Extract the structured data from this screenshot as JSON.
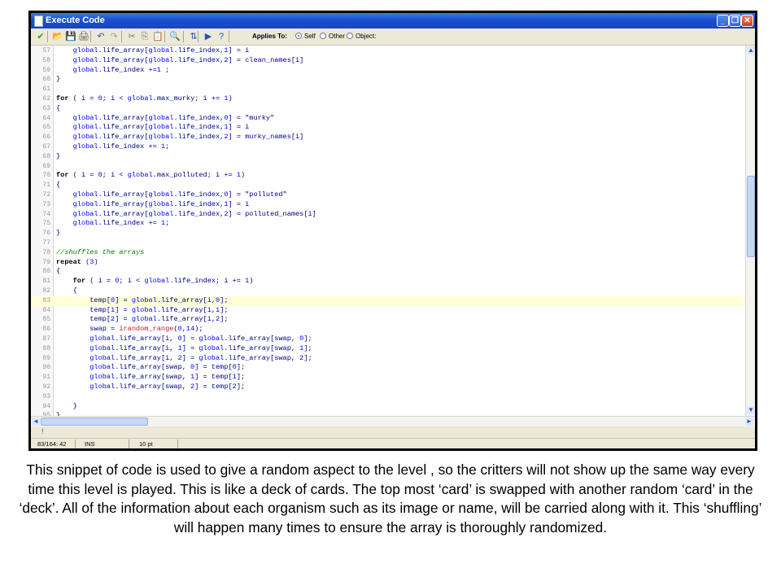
{
  "window": {
    "title": "Execute Code",
    "min_glyph": "_",
    "max_glyph": "❐",
    "close_glyph": "✕"
  },
  "toolbar": {
    "icons": [
      {
        "name": "check-icon",
        "glyph": "✔",
        "color": "#2e9a2e"
      },
      {
        "name": "open-folder-icon",
        "glyph": "📂",
        "color": "#c99a1a"
      },
      {
        "name": "save-icon",
        "glyph": "💾",
        "color": "#2b55a8"
      },
      {
        "name": "print-icon",
        "glyph": "🖨",
        "color": "#555555"
      },
      {
        "name": "undo-icon",
        "glyph": "↶",
        "color": "#2b55a8"
      },
      {
        "name": "redo-icon",
        "glyph": "↷",
        "color": "#9a9a9a"
      },
      {
        "name": "cut-icon",
        "glyph": "✂",
        "color": "#777777"
      },
      {
        "name": "copy-icon",
        "glyph": "⎘",
        "color": "#777777"
      },
      {
        "name": "paste-icon",
        "glyph": "📋",
        "color": "#777777"
      },
      {
        "name": "search-icon",
        "glyph": "🔍",
        "color": "#555555"
      },
      {
        "name": "goto-line-icon",
        "glyph": "⇅",
        "color": "#2b55a8"
      },
      {
        "name": "run-icon",
        "glyph": "▶",
        "color": "#2b55a8"
      },
      {
        "name": "help-icon",
        "glyph": "?",
        "color": "#2b55a8"
      }
    ],
    "applies_to_label": "Applies To:",
    "options": [
      {
        "label": "Self",
        "selected": true
      },
      {
        "label": "Other",
        "selected": false
      },
      {
        "label": "Object:",
        "selected": false
      }
    ]
  },
  "editor": {
    "lines": [
      {
        "n": "57",
        "text": "    global.life_array[global.life_index,1] = i"
      },
      {
        "n": "58",
        "text": "    global.life_array[global.life_index,2] = clean_names[i]"
      },
      {
        "n": "59",
        "text": "    global.life_index +=1 ;"
      },
      {
        "n": "60",
        "text": "}"
      },
      {
        "n": "61",
        "text": ""
      },
      {
        "n": "62",
        "text": "for ( i = 0; i < global.max_murky; i += 1)"
      },
      {
        "n": "63",
        "text": "{"
      },
      {
        "n": "64",
        "text": "    global.life_array[global.life_index,0] = \"murky\""
      },
      {
        "n": "65",
        "text": "    global.life_array[global.life_index,1] = i"
      },
      {
        "n": "66",
        "text": "    global.life_array[global.life_index,2] = murky_names[i]"
      },
      {
        "n": "67",
        "text": "    global.life_index += 1;"
      },
      {
        "n": "68",
        "text": "}"
      },
      {
        "n": "69",
        "text": ""
      },
      {
        "n": "70",
        "text": "for ( i = 0; i < global.max_polluted; i += 1)"
      },
      {
        "n": "71",
        "text": "{"
      },
      {
        "n": "72",
        "text": "    global.life_array[global.life_index,0] = \"polluted\""
      },
      {
        "n": "73",
        "text": "    global.life_array[global.life_index,1] = i"
      },
      {
        "n": "74",
        "text": "    global.life_array[global.life_index,2] = polluted_names[i]"
      },
      {
        "n": "75",
        "text": "    global.life_index += 1;"
      },
      {
        "n": "76",
        "text": "}"
      },
      {
        "n": "77",
        "text": ""
      },
      {
        "n": "78",
        "text": "//shuffles the arrays"
      },
      {
        "n": "79",
        "text": "repeat (3)"
      },
      {
        "n": "80",
        "text": "{"
      },
      {
        "n": "81",
        "text": "    for ( i = 0; i < global.life_index; i += 1)"
      },
      {
        "n": "82",
        "text": "    {"
      },
      {
        "n": "83",
        "text": "        temp[0] = global.life_array[i,0];",
        "highlight": true
      },
      {
        "n": "84",
        "text": "        temp[1] = global.life_array[i,1];"
      },
      {
        "n": "85",
        "text": "        temp[2] = global.life_array[i,2];"
      },
      {
        "n": "86",
        "text": "        swap = irandom_range(0,14);"
      },
      {
        "n": "87",
        "text": "        global.life_array[i, 0] = global.life_array[swap, 0];"
      },
      {
        "n": "88",
        "text": "        global.life_array[i, 1] = global.life_array[swap, 1];"
      },
      {
        "n": "89",
        "text": "        global.life_array[i, 2] = global.life_array[swap, 2];"
      },
      {
        "n": "90",
        "text": "        global.life_array[swap, 0] = temp[0];"
      },
      {
        "n": "91",
        "text": "        global.life_array[swap, 1] = temp[1];"
      },
      {
        "n": "92",
        "text": "        global.life_array[swap, 2] = temp[2];"
      },
      {
        "n": "93",
        "text": ""
      },
      {
        "n": "94",
        "text": "    }"
      },
      {
        "n": "95",
        "text": "}"
      }
    ]
  },
  "scroll": {
    "up": "▲",
    "down": "▼",
    "left": "◄",
    "right": "►"
  },
  "message_bar": {
    "text": "!"
  },
  "status": {
    "position": "83/164: 42",
    "mode": "INS",
    "font_size": "10 pt"
  },
  "caption": "This snippet of code is used to give a random aspect to the level , so the critters will not show up the same way every time this level is played. This is like a deck of cards. The top most ‘card’ is swapped with another random ‘card’ in the ‘deck’. All of the information about each organism such as its image or name, will be carried along with it. This ‘shuffling’ will happen many times to ensure the array is thoroughly randomized."
}
